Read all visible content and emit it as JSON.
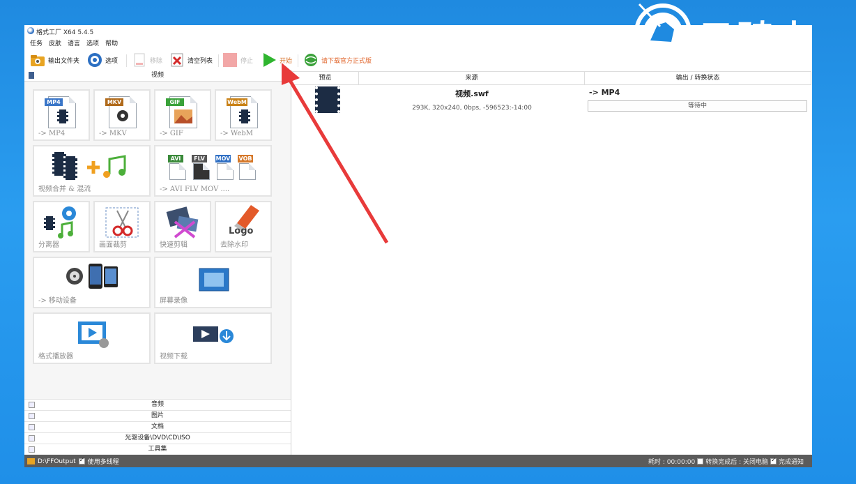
{
  "window": {
    "title": "格式工厂 X64 5.4.5"
  },
  "menu": [
    "任务",
    "皮肤",
    "语言",
    "选项",
    "帮助"
  ],
  "toolbar": {
    "output_folder": "输出文件夹",
    "options": "选项",
    "remove": "移除",
    "clear_list": "清空列表",
    "stop": "停止",
    "start": "开始",
    "download": "请下载官方正式版"
  },
  "left_panel": {
    "video_header": "视频",
    "tiles": [
      {
        "label": "-> MP4",
        "badge": "MP4",
        "badge_color": "#3a76c8"
      },
      {
        "label": "-> MKV",
        "badge": "MKV",
        "badge_color": "#b06a1b"
      },
      {
        "label": "-> GIF",
        "badge": "GIF",
        "badge_color": "#3aa23a"
      },
      {
        "label": "-> WebM",
        "badge": "WebM",
        "badge_color": "#c98218"
      },
      {
        "label": "视频合并 & 混流"
      },
      {
        "label": "-> AVI FLV MOV ....",
        "badges": [
          "AVI",
          "FLV",
          "MOV",
          "VOB"
        ]
      },
      {
        "label": "分离器"
      },
      {
        "label": "画面裁剪"
      },
      {
        "label": "快速剪辑"
      },
      {
        "label": "去除水印",
        "logo_text": "Logo"
      },
      {
        "label": "-> 移动设备"
      },
      {
        "label": "屏幕录像"
      },
      {
        "label": "格式播放器"
      },
      {
        "label": "视频下载"
      }
    ],
    "bottom_categories": [
      "音频",
      "图片",
      "文档",
      "光驱设备\\DVD\\CD\\ISO",
      "工具集"
    ]
  },
  "task_table": {
    "headers": [
      "预览",
      "来源",
      "输出 / 转换状态"
    ],
    "rows": [
      {
        "filename": "视频.swf",
        "info": "293K, 320x240, 0bps, -596523:-14:00",
        "output": "-> MP4",
        "status": "等待中"
      }
    ]
  },
  "statusbar": {
    "output_path": "D:\\FFOutput",
    "multithread": "使用多线程",
    "elapsed": "耗时 : 00:00:00",
    "after_convert": "转换完成后 : 关闭电脑",
    "notify": "完成通知"
  },
  "watermark": {
    "text": "云骑士"
  },
  "colors": {
    "accent_arrow": "#e83a3a",
    "start_green": "#2fb52f",
    "statusbar": "#5b5b5b",
    "desktop": "#1f8ae0"
  }
}
